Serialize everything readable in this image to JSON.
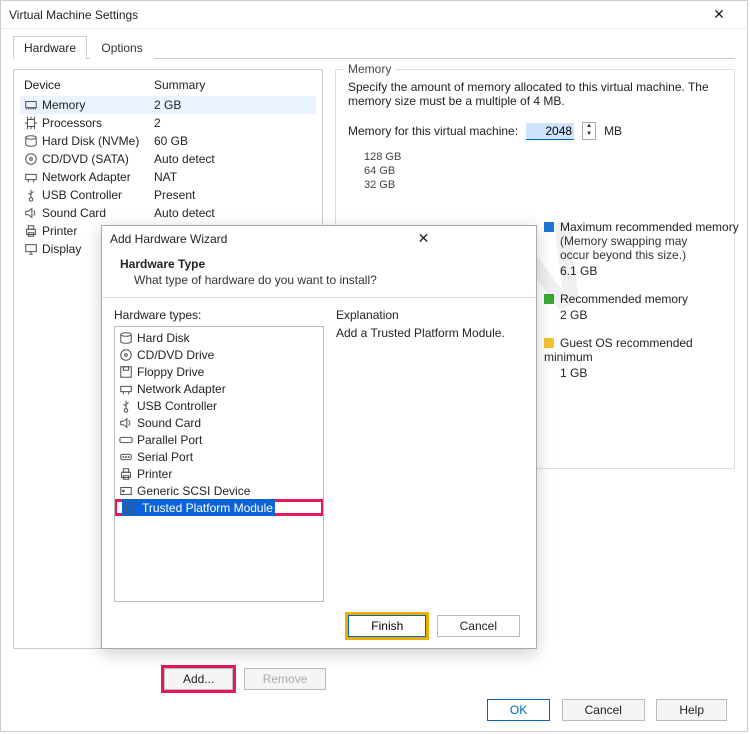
{
  "window": {
    "title": "Virtual Machine Settings"
  },
  "tabs": {
    "hardware": "Hardware",
    "options": "Options"
  },
  "device_table": {
    "col1": "Device",
    "col2": "Summary",
    "rows": [
      {
        "name": "Memory",
        "summary": "2 GB",
        "selected": true
      },
      {
        "name": "Processors",
        "summary": "2"
      },
      {
        "name": "Hard Disk (NVMe)",
        "summary": "60 GB"
      },
      {
        "name": "CD/DVD (SATA)",
        "summary": "Auto detect"
      },
      {
        "name": "Network Adapter",
        "summary": "NAT"
      },
      {
        "name": "USB Controller",
        "summary": "Present"
      },
      {
        "name": "Sound Card",
        "summary": "Auto detect"
      },
      {
        "name": "Printer",
        "summary": ""
      },
      {
        "name": "Display",
        "summary": ""
      }
    ],
    "add": "Add...",
    "remove": "Remove"
  },
  "memory_panel": {
    "legend": "Memory",
    "desc": "Specify the amount of memory allocated to this virtual machine. The memory size must be a multiple of 4 MB.",
    "label": "Memory for this virtual machine:",
    "value": "2048",
    "unit": "MB",
    "scale": [
      "128 GB",
      "64 GB",
      "32 GB"
    ],
    "legend_items": {
      "max": {
        "title": "Maximum recommended memory",
        "sub1": "(Memory swapping may",
        "sub2": "occur beyond this size.)",
        "val": "6.1 GB",
        "color": "#1e74d2"
      },
      "rec": {
        "title": "Recommended memory",
        "val": "2 GB",
        "color": "#3faa36"
      },
      "min": {
        "title": "Guest OS recommended minimum",
        "val": "1 GB",
        "color": "#f4c430"
      }
    }
  },
  "wizard": {
    "title": "Add Hardware Wizard",
    "heading": "Hardware Type",
    "sub": "What type of hardware do you want to install?",
    "list_label": "Hardware types:",
    "exp_label": "Explanation",
    "explanation": "Add a Trusted Platform Module.",
    "items": [
      "Hard Disk",
      "CD/DVD Drive",
      "Floppy Drive",
      "Network Adapter",
      "USB Controller",
      "Sound Card",
      "Parallel Port",
      "Serial Port",
      "Printer",
      "Generic SCSI Device",
      "Trusted Platform Module"
    ],
    "finish": "Finish",
    "cancel": "Cancel"
  },
  "footer": {
    "ok": "OK",
    "cancel": "Cancel",
    "help": "Help"
  },
  "watermark": "ARDIMN"
}
